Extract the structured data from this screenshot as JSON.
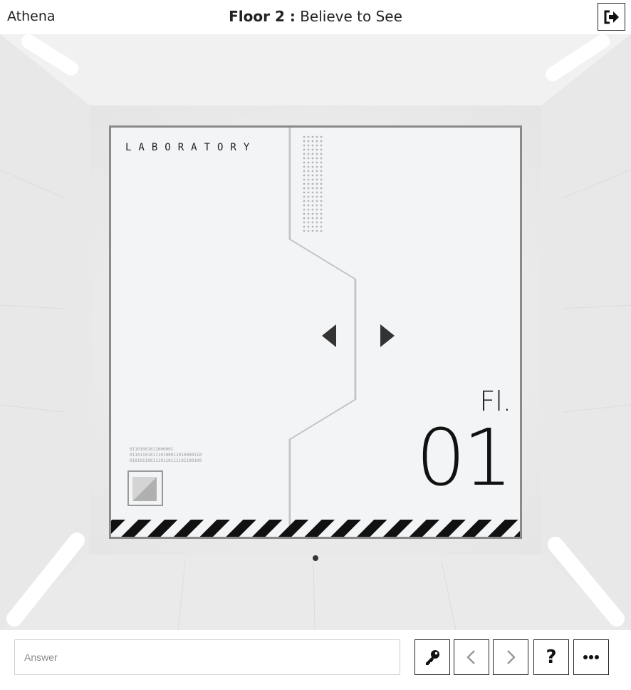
{
  "header": {
    "app_name": "Athena",
    "floor_label": "Floor 2 :",
    "puzzle_name": "Believe to See",
    "exit_icon": "sign-out-icon"
  },
  "panel": {
    "lab_label": "LABORATORY",
    "fl_label": "Fl.",
    "floor_number": "01",
    "binary_text": "01101001011000001\n0110110101110100011010000110\n0101011001110110111101100100",
    "nav_left_icon": "triangle-left-icon",
    "nav_right_icon": "triangle-right-icon",
    "page_indicator_count": 1,
    "page_indicator_active": 1
  },
  "bottom": {
    "answer_value": "",
    "answer_placeholder": "Answer",
    "buttons": [
      {
        "name": "key-icon"
      },
      {
        "name": "chevron-left-icon"
      },
      {
        "name": "chevron-right-icon"
      },
      {
        "name": "question-icon",
        "label": "?"
      },
      {
        "name": "more-icon"
      }
    ]
  },
  "colors": {
    "frame": "#8a8a8a",
    "accent_dark": "#111111",
    "scene_bg": "#ececec"
  }
}
